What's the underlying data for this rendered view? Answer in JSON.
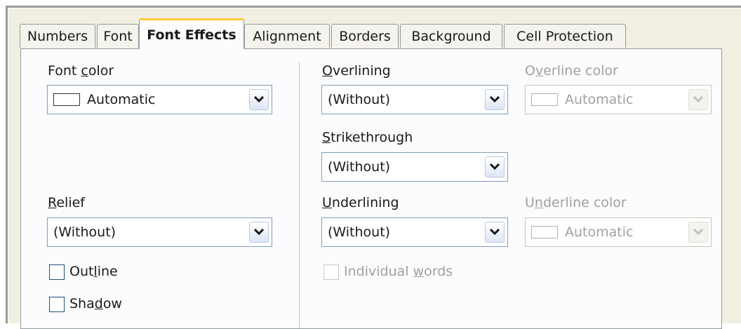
{
  "tabs": [
    {
      "label": "Numbers"
    },
    {
      "label": "Font"
    },
    {
      "label": "Font Effects"
    },
    {
      "label": "Alignment"
    },
    {
      "label": "Borders"
    },
    {
      "label": "Background"
    },
    {
      "label": "Cell Protection"
    }
  ],
  "font_color": {
    "pre": "Font ",
    "key": "c",
    "post": "olor",
    "value": "Automatic"
  },
  "relief": {
    "pre": "",
    "key": "R",
    "post": "elief",
    "value": "(Without)"
  },
  "outline": {
    "pre": "Out",
    "key": "l",
    "post": "ine",
    "checked": false
  },
  "shadow": {
    "pre": "Sha",
    "key": "d",
    "post": "ow",
    "checked": false
  },
  "overlining": {
    "pre": "",
    "key": "O",
    "post": "verlining",
    "value": "(Without)"
  },
  "overline_color": {
    "pre": "O",
    "key": "v",
    "post": "erline color",
    "value": "Automatic"
  },
  "strikethrough": {
    "pre": "",
    "key": "S",
    "post": "trikethrough",
    "value": "(Without)"
  },
  "underlining": {
    "pre": "",
    "key": "U",
    "post": "nderlining",
    "value": "(Without)"
  },
  "underline_color": {
    "pre": "U",
    "key": "n",
    "post": "derline color",
    "value": "Automatic"
  },
  "individual_words": {
    "pre": "Individual ",
    "key": "w",
    "post": "ords",
    "checked": false
  }
}
